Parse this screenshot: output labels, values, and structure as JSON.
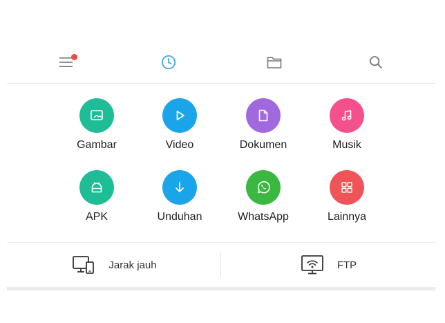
{
  "toolbar": {
    "menu_icon": "menu-icon",
    "recent_icon": "clock-icon",
    "folder_icon": "folder-icon",
    "search_icon": "search-icon",
    "notification_dot_color": "#f04848",
    "active_color": "#3aa3e3",
    "inactive_color": "#777777"
  },
  "categories": [
    {
      "label": "Gambar",
      "icon": "image-icon",
      "color": "#1ebd96"
    },
    {
      "label": "Video",
      "icon": "play-icon",
      "color": "#1aa4ea"
    },
    {
      "label": "Dokumen",
      "icon": "document-icon",
      "color": "#a169e0"
    },
    {
      "label": "Musik",
      "icon": "music-icon",
      "color": "#f4508e"
    },
    {
      "label": "APK",
      "icon": "android-icon",
      "color": "#1ebd96"
    },
    {
      "label": "Unduhan",
      "icon": "download-icon",
      "color": "#1aa4ea"
    },
    {
      "label": "WhatsApp",
      "icon": "whatsapp-icon",
      "color": "#3bb83f"
    },
    {
      "label": "Lainnya",
      "icon": "grid-icon",
      "color": "#ee5458"
    }
  ],
  "quick_access": [
    {
      "label": "Jarak jauh",
      "icon": "remote-devices-icon"
    },
    {
      "label": "FTP",
      "icon": "ftp-monitor-icon"
    }
  ]
}
